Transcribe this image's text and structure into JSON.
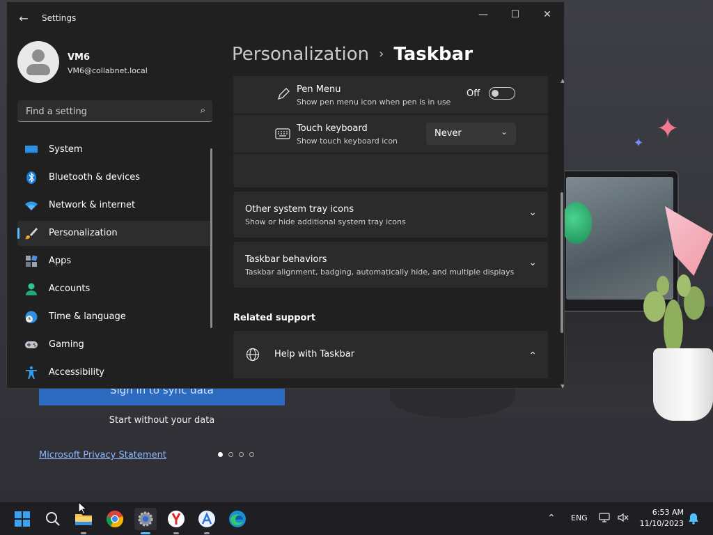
{
  "background_app": {
    "signin_label": "Sign in to sync data",
    "start_label": "Start without your data",
    "privacy_link": "Microsoft Privacy Statement",
    "page_dots": 4,
    "active_dot": 1
  },
  "window": {
    "title": "Settings",
    "accent": "#4cc2ff"
  },
  "profile": {
    "name": "VM6",
    "email": "VM6@collabnet.local"
  },
  "search": {
    "placeholder": "Find a setting"
  },
  "sidebar": {
    "items": [
      {
        "label": "System",
        "icon": "monitor-icon"
      },
      {
        "label": "Bluetooth & devices",
        "icon": "bluetooth-icon"
      },
      {
        "label": "Network & internet",
        "icon": "wifi-icon"
      },
      {
        "label": "Personalization",
        "icon": "paintbrush-icon",
        "active": true
      },
      {
        "label": "Apps",
        "icon": "apps-icon"
      },
      {
        "label": "Accounts",
        "icon": "person-icon"
      },
      {
        "label": "Time & language",
        "icon": "globe-clock-icon"
      },
      {
        "label": "Gaming",
        "icon": "gamepad-icon"
      },
      {
        "label": "Accessibility",
        "icon": "accessibility-icon"
      }
    ]
  },
  "breadcrumb": {
    "parent": "Personalization",
    "separator": "›",
    "current": "Taskbar"
  },
  "content": {
    "pen_menu": {
      "title": "Pen Menu",
      "desc": "Show pen menu icon when pen is in use",
      "state": "Off"
    },
    "touch_keyboard": {
      "title": "Touch keyboard",
      "desc": "Show touch keyboard icon",
      "value": "Never"
    },
    "other_tray": {
      "title": "Other system tray icons",
      "desc": "Show or hide additional system tray icons"
    },
    "behaviors": {
      "title": "Taskbar behaviors",
      "desc": "Taskbar alignment, badging, automatically hide, and multiple displays"
    },
    "related_support": "Related support",
    "help": {
      "title": "Help with Taskbar"
    }
  },
  "taskbar": {
    "apps": [
      "start-icon",
      "search-icon",
      "file-explorer-icon",
      "chrome-icon",
      "settings-icon",
      "yandex-icon",
      "app-installer-icon",
      "edge-icon"
    ],
    "language": "ENG",
    "time": "6:53 AM",
    "date": "11/10/2023"
  }
}
